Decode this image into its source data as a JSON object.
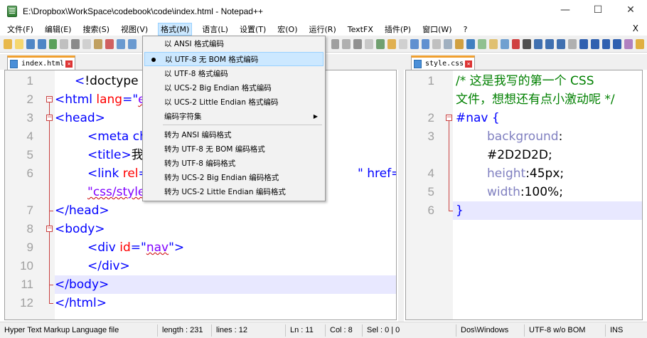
{
  "window": {
    "title": "E:\\Dropbox\\WorkSpace\\codebook\\code\\index.html - Notepad++",
    "minimize": "—",
    "maximize": "☐",
    "close": "✕"
  },
  "menu": {
    "items": [
      "文件(F)",
      "编辑(E)",
      "搜索(S)",
      "视图(V)",
      "格式(M)",
      "语言(L)",
      "设置(T)",
      "宏(O)",
      "运行(R)",
      "TextFX",
      "插件(P)",
      "窗口(W)",
      "?"
    ],
    "close_x": "X",
    "open_index": 4
  },
  "format_menu": {
    "items": [
      {
        "label": "以 ANSI 格式编码",
        "checked": false,
        "highlighted": false
      },
      {
        "label": "以 UTF-8 无 BOM 格式编码",
        "checked": true,
        "highlighted": true
      },
      {
        "label": "以 UTF-8 格式编码",
        "checked": false,
        "highlighted": false
      },
      {
        "label": "以 UCS-2 Big Endian 格式编码",
        "checked": false,
        "highlighted": false
      },
      {
        "label": "以 UCS-2 Little Endian 格式编码",
        "checked": false,
        "highlighted": false
      },
      {
        "label": "编码字符集",
        "submenu": true
      },
      {
        "label": "转为 ANSI 编码格式"
      },
      {
        "label": "转为 UTF-8 无 BOM 编码格式"
      },
      {
        "label": "转为 UTF-8 编码格式"
      },
      {
        "label": "转为 UCS-2 Big Endian 编码格式"
      },
      {
        "label": "转为 UCS-2 Little Endian 编码格式"
      }
    ]
  },
  "tabs": {
    "left": "index.html",
    "right": "style.css"
  },
  "left_editor": {
    "lines": [
      {
        "num": "1",
        "parts": [
          [
            "t-tag",
            "<"
          ],
          [
            "t-txt",
            "!doctype htm"
          ]
        ]
      },
      {
        "num": "2",
        "parts": [
          [
            "t-tag",
            "<html "
          ],
          [
            "t-attr",
            "lang"
          ],
          [
            "t-tag",
            "=\""
          ],
          [
            "t-str",
            "e"
          ]
        ]
      },
      {
        "num": "3",
        "parts": [
          [
            "t-tag",
            "<head>"
          ]
        ]
      },
      {
        "num": "4",
        "parts": [
          [
            "t-tag",
            "<meta ch"
          ]
        ]
      },
      {
        "num": "5",
        "parts": [
          [
            "t-tag",
            "<title>"
          ],
          [
            "t-txt",
            "我"
          ]
        ]
      },
      {
        "num": "6",
        "parts": [
          [
            "t-tag",
            "<link "
          ],
          [
            "t-attr",
            "rel"
          ],
          [
            "t-tag",
            "="
          ]
        ]
      },
      {
        "num": "",
        "parts": [
          [
            "t-str",
            "\"css/style"
          ]
        ]
      },
      {
        "num": "7",
        "parts": [
          [
            "t-tag",
            "</head>"
          ]
        ]
      },
      {
        "num": "8",
        "parts": [
          [
            "t-tag",
            "<body>"
          ]
        ]
      },
      {
        "num": "9",
        "parts": [
          [
            "t-tag",
            "<div "
          ],
          [
            "t-attr",
            "id"
          ],
          [
            "t-tag",
            "=\""
          ],
          [
            "t-str",
            "nav"
          ],
          [
            "t-tag",
            "\">"
          ]
        ]
      },
      {
        "num": "10",
        "parts": [
          [
            "t-tag",
            "</div>"
          ]
        ]
      },
      {
        "num": "11",
        "parts": [
          [
            "t-tag",
            "</body>"
          ]
        ]
      },
      {
        "num": "12",
        "parts": [
          [
            "t-tag",
            "</html>"
          ]
        ]
      }
    ],
    "href_fragment": "\" href="
  },
  "right_editor": {
    "lines": [
      {
        "num": "1",
        "parts": [
          [
            "t-com",
            "/* 这是我写的第一个 CSS"
          ]
        ]
      },
      {
        "num": "",
        "parts": [
          [
            "t-com",
            "文件，想想还有点小激动呢 */"
          ]
        ]
      },
      {
        "num": "2",
        "parts": [
          [
            "t-sel",
            "#nav "
          ],
          [
            "t-tag",
            "{"
          ]
        ]
      },
      {
        "num": "3",
        "parts": [
          [
            "t-prop",
            "background"
          ],
          [
            "t-val",
            ":"
          ]
        ]
      },
      {
        "num": "",
        "parts": [
          [
            "t-val",
            "#2D2D2D;"
          ]
        ]
      },
      {
        "num": "4",
        "parts": [
          [
            "t-prop",
            "height"
          ],
          [
            "t-val",
            ":45px;"
          ]
        ]
      },
      {
        "num": "5",
        "parts": [
          [
            "t-prop",
            "width"
          ],
          [
            "t-val",
            ":100%;"
          ]
        ]
      },
      {
        "num": "6",
        "parts": [
          [
            "t-tag",
            "}"
          ]
        ]
      }
    ]
  },
  "status": {
    "file_type": "Hyper Text Markup Language file",
    "length": "length : 231",
    "lines": "lines : 12",
    "ln": "Ln : 11",
    "col": "Col : 8",
    "sel": "Sel : 0 | 0",
    "eol": "Dos\\Windows",
    "encoding": "UTF-8 w/o BOM",
    "mode": "INS"
  },
  "colors": {
    "tag": "#0000ff",
    "attr": "#ff0000",
    "string": "#8000ff",
    "comment": "#008000",
    "current_line": "#e8e8ff",
    "tab_accent": "#f0a030"
  }
}
